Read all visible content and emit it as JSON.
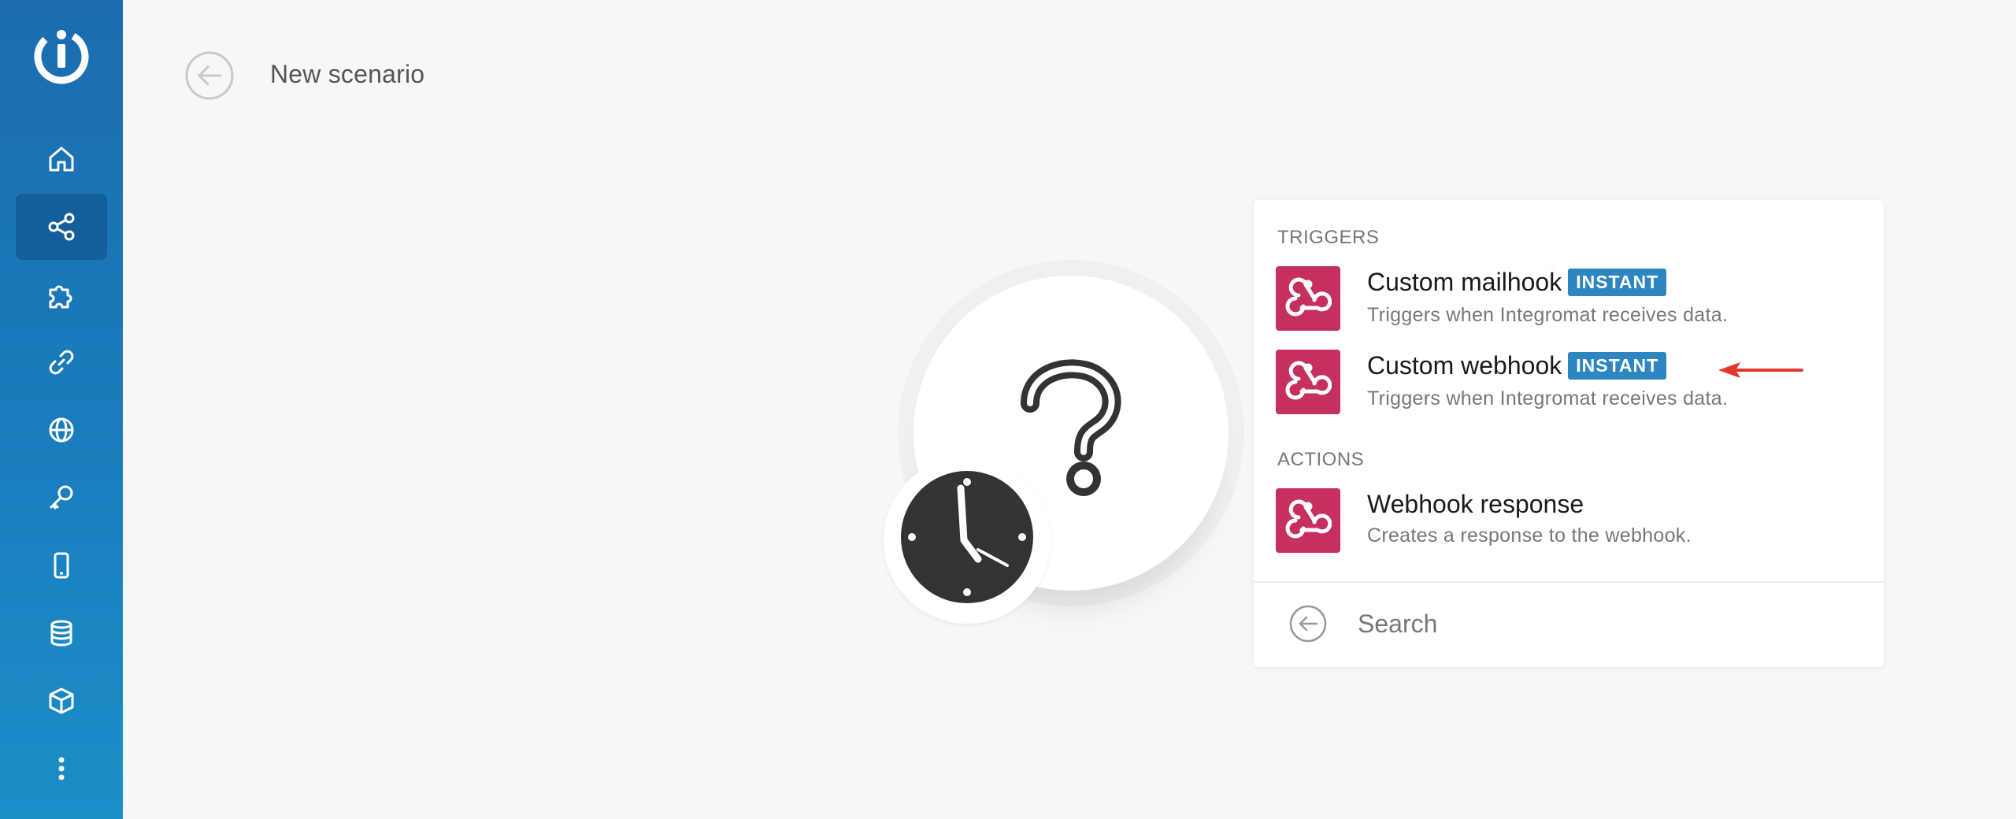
{
  "header": {
    "title": "New scenario",
    "back_icon": "arrow-left-circle-icon"
  },
  "sidebar": {
    "logo": "integromat-logo",
    "items": [
      {
        "icon": "home-icon",
        "active": false
      },
      {
        "icon": "share-icon",
        "active": true
      },
      {
        "icon": "puzzle-icon",
        "active": false
      },
      {
        "icon": "link-icon",
        "active": false
      },
      {
        "icon": "globe-icon",
        "active": false
      },
      {
        "icon": "key-icon",
        "active": false
      },
      {
        "icon": "phone-icon",
        "active": false
      },
      {
        "icon": "database-icon",
        "active": false
      },
      {
        "icon": "box-icon",
        "active": false
      },
      {
        "icon": "more-vertical-icon",
        "active": false
      }
    ],
    "colors": {
      "top": "#1b6cb0",
      "bottom": "#1c8ec8"
    }
  },
  "canvas": {
    "module_icon": "question-mark-icon",
    "schedule_icon": "clock-icon"
  },
  "panel": {
    "triggers_label": "TRIGGERS",
    "actions_label": "ACTIONS",
    "triggers": [
      {
        "title": "Custom mailhook",
        "badge": "INSTANT",
        "description": "Triggers when Integromat receives data.",
        "icon": "webhook-icon"
      },
      {
        "title": "Custom webhook",
        "badge": "INSTANT",
        "description": "Triggers when Integromat receives data.",
        "icon": "webhook-icon",
        "annotation": "red-arrow-icon"
      }
    ],
    "actions": [
      {
        "title": "Webhook response",
        "description": "Creates a response to the webhook.",
        "icon": "webhook-icon"
      }
    ],
    "search": {
      "placeholder": "Search",
      "value": ""
    },
    "colors": {
      "module_icon_bg": "#c5305f",
      "badge_bg": "#2e86c1",
      "annotation_arrow": "#e5362b"
    }
  }
}
